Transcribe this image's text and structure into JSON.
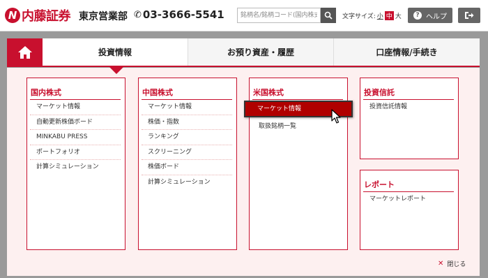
{
  "header": {
    "logo_text": "内藤証券",
    "logo_mark": "N",
    "branch": "東京営業部",
    "phone": "03-3666-5541",
    "search_placeholder": "銘柄名/銘柄コード(国内株式)",
    "font_size_label": "文字サイズ:",
    "font_size_small": "小",
    "font_size_mid": "中",
    "font_size_large": "大",
    "help_label": "ヘルプ",
    "help_icon": "question-circle-icon",
    "logout_icon": "logout-icon"
  },
  "nav": {
    "home_icon": "home-icon",
    "tabs": [
      {
        "label": "投資情報"
      },
      {
        "label": "お預り資産・履歴"
      },
      {
        "label": "口座情報/手続き"
      }
    ]
  },
  "menu": {
    "domestic": {
      "title": "国内株式",
      "links": [
        "マーケット情報",
        "自動更新株価ボード",
        "MINKABU PRESS",
        "ポートフォリオ",
        "計算シミュレーション"
      ]
    },
    "china": {
      "title": "中国株式",
      "links": [
        "マーケット情報",
        "株価・指数",
        "ランキング",
        "スクリーニング",
        "株価ボード",
        "計算シミュレーション"
      ]
    },
    "us": {
      "title": "米国株式",
      "links": [
        "マーケット情報",
        "取扱銘柄一覧"
      ]
    },
    "fund": {
      "title": "投資信託",
      "links": [
        "投資信託情報"
      ]
    },
    "report": {
      "title": "レポート",
      "links": [
        "マーケットレポート"
      ]
    },
    "close_label": "閉じる"
  },
  "colors": {
    "brand": "#c8102e",
    "highlight": "#b00000",
    "panel_bg": "#fdf0f0"
  }
}
